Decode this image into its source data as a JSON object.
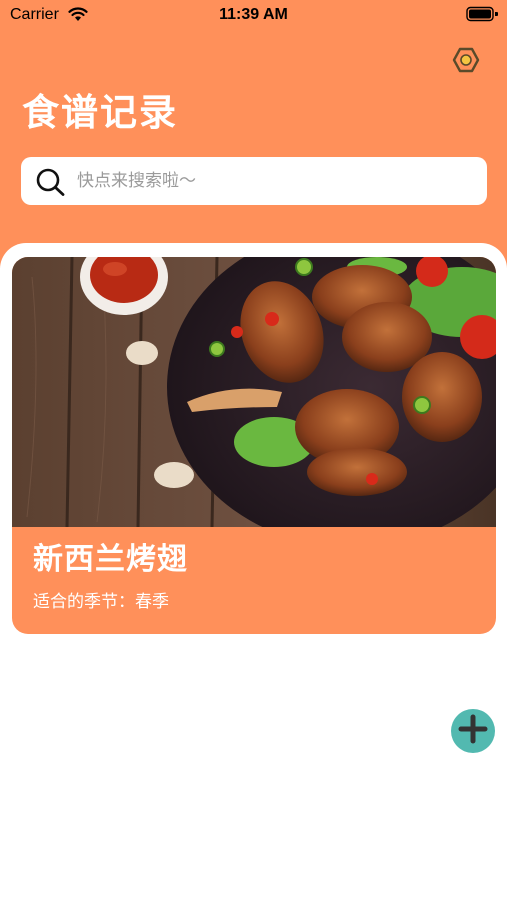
{
  "status_bar": {
    "carrier": "Carrier",
    "time": "11:39 AM"
  },
  "header": {
    "title": "食谱记录",
    "settings_icon": "hexagon-settings-icon"
  },
  "search": {
    "placeholder": "快点来搜索啦～",
    "value": "",
    "icon": "search-icon"
  },
  "recipes": [
    {
      "name": "新西兰烤翅",
      "season_label": "适合的季节：",
      "season": "春季",
      "image": "grilled-chicken-wings-photo"
    }
  ],
  "fab": {
    "icon": "plus-icon"
  },
  "colors": {
    "primary": "#FF905A",
    "fab": "#52B9B0",
    "background": "#FFFFFF"
  }
}
